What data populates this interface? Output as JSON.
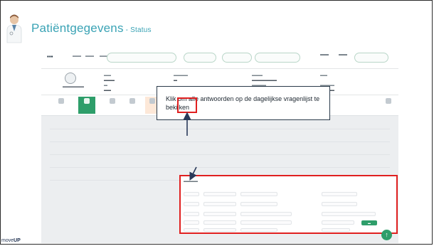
{
  "slide": {
    "title_main": "Patiëntgegevens",
    "title_sep": " - ",
    "title_sub": "Status"
  },
  "callout": {
    "text": "Klik om alle antwoorden op de dagelijkse vragenlijst te bekijken"
  },
  "brand": {
    "prefix": "move",
    "suffix": "UP"
  },
  "colors": {
    "accent_teal": "#3aa3b5",
    "green": "#2e9e6a",
    "highlight_red": "#e02020"
  }
}
